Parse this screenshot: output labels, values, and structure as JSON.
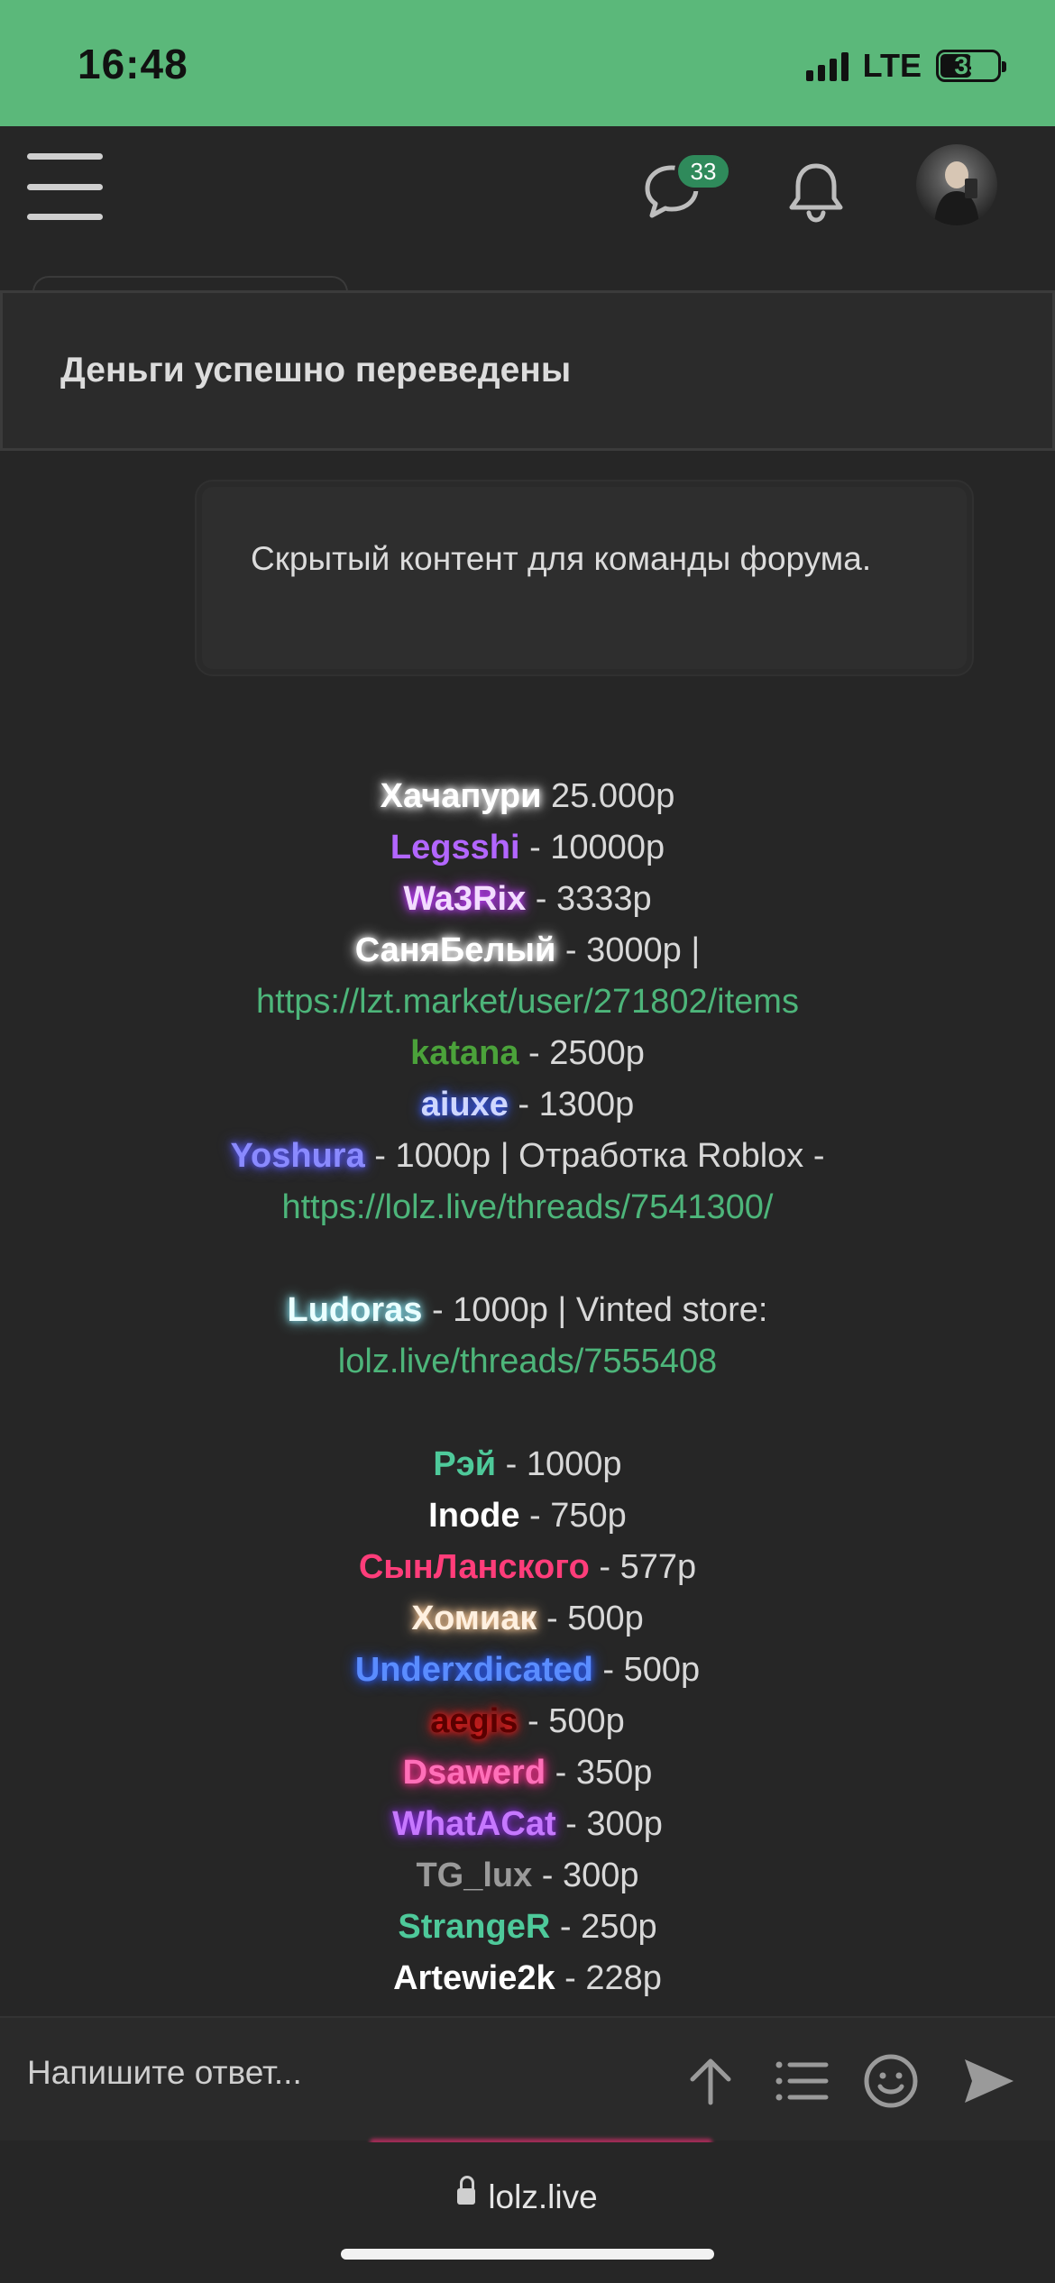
{
  "status_bar": {
    "time": "16:48",
    "network": "LTE",
    "battery": "35"
  },
  "nav": {
    "messages_badge": "33"
  },
  "toast": {
    "text": "Деньги успешно переведены"
  },
  "hidden_content": {
    "text": "Скрытый контент для команды форума."
  },
  "donations": [
    {
      "user": "Хачапури",
      "color": "#ffffff",
      "glow": "#ffffff",
      "rest": " 25.000р"
    },
    {
      "user": "Legsshi",
      "color": "#b266ff",
      "rest": " - 10000р"
    },
    {
      "user": "Wa3Rix",
      "color": "#f3dcff",
      "glow": "#c13cff",
      "rest": " - 3333р"
    },
    {
      "user": "СаняБелый",
      "color": "#ffffff",
      "glow": "#ffffff",
      "rest": " - 3000р |"
    },
    {
      "link": "https://lzt.market/user/271802/items"
    },
    {
      "user": "katana",
      "color": "#4ba23a",
      "rest": " - 2500р"
    },
    {
      "user": "aiuxe",
      "color": "#cfd7ff",
      "glow": "#3a5cff",
      "rest": " - 1300р"
    },
    {
      "user": "Yoshura",
      "color": "#8a8aff",
      "glow": "#5a5aff",
      "rest": " - 1000р | Отработка Roblox -"
    },
    {
      "link": "https://lolz.live/threads/7541300/"
    },
    {
      "gap": true
    },
    {
      "user": "Ludoras",
      "color": "#eaffff",
      "glow": "#8ff0ff",
      "rest": " - 1000р | Vinted store:"
    },
    {
      "link": "lolz.live/threads/7555408"
    },
    {
      "gap": true
    },
    {
      "user": "Рэй",
      "color": "#4ec99a",
      "rest": " - 1000р"
    },
    {
      "user": "Inode",
      "color": "#ffffff",
      "rest": " - 750р"
    },
    {
      "user": "СынЛанского",
      "color": "#ff3d7a",
      "rest": " - 577р"
    },
    {
      "user": "Хомиак",
      "color": "#fff0e0",
      "glow": "#ffcc99",
      "rest": " - 500р"
    },
    {
      "user": "Underxdicated",
      "color": "#5a8cff",
      "glow": "#2a5cff",
      "rest": " - 500р"
    },
    {
      "user": "aegis",
      "color": "#5a0000",
      "glow": "#ff1a1a",
      "rest": " - 500р"
    },
    {
      "user": "Dsawerd",
      "color": "#ff6fb8",
      "glow": "#ff2d8f",
      "rest": " - 350р"
    },
    {
      "user": "WhatACat",
      "color": "#c678ff",
      "glow": "#8a2be2",
      "rest": " - 300р"
    },
    {
      "user": "TG_lux",
      "color": "#9a9a9a",
      "rest": " - 300р"
    },
    {
      "user": "StrangeR",
      "color": "#4ec99a",
      "rest": " - 250р"
    },
    {
      "user": "Artewie2k",
      "color": "#ffffff",
      "rest": " - 228р"
    }
  ],
  "composer": {
    "placeholder": "Напишите ответ..."
  },
  "browser": {
    "url": "lolz.live"
  },
  "icons": [
    "menu-icon",
    "chat-icon",
    "bell-icon",
    "arrow-up-icon",
    "list-icon",
    "smile-icon",
    "send-icon",
    "lock-icon"
  ]
}
